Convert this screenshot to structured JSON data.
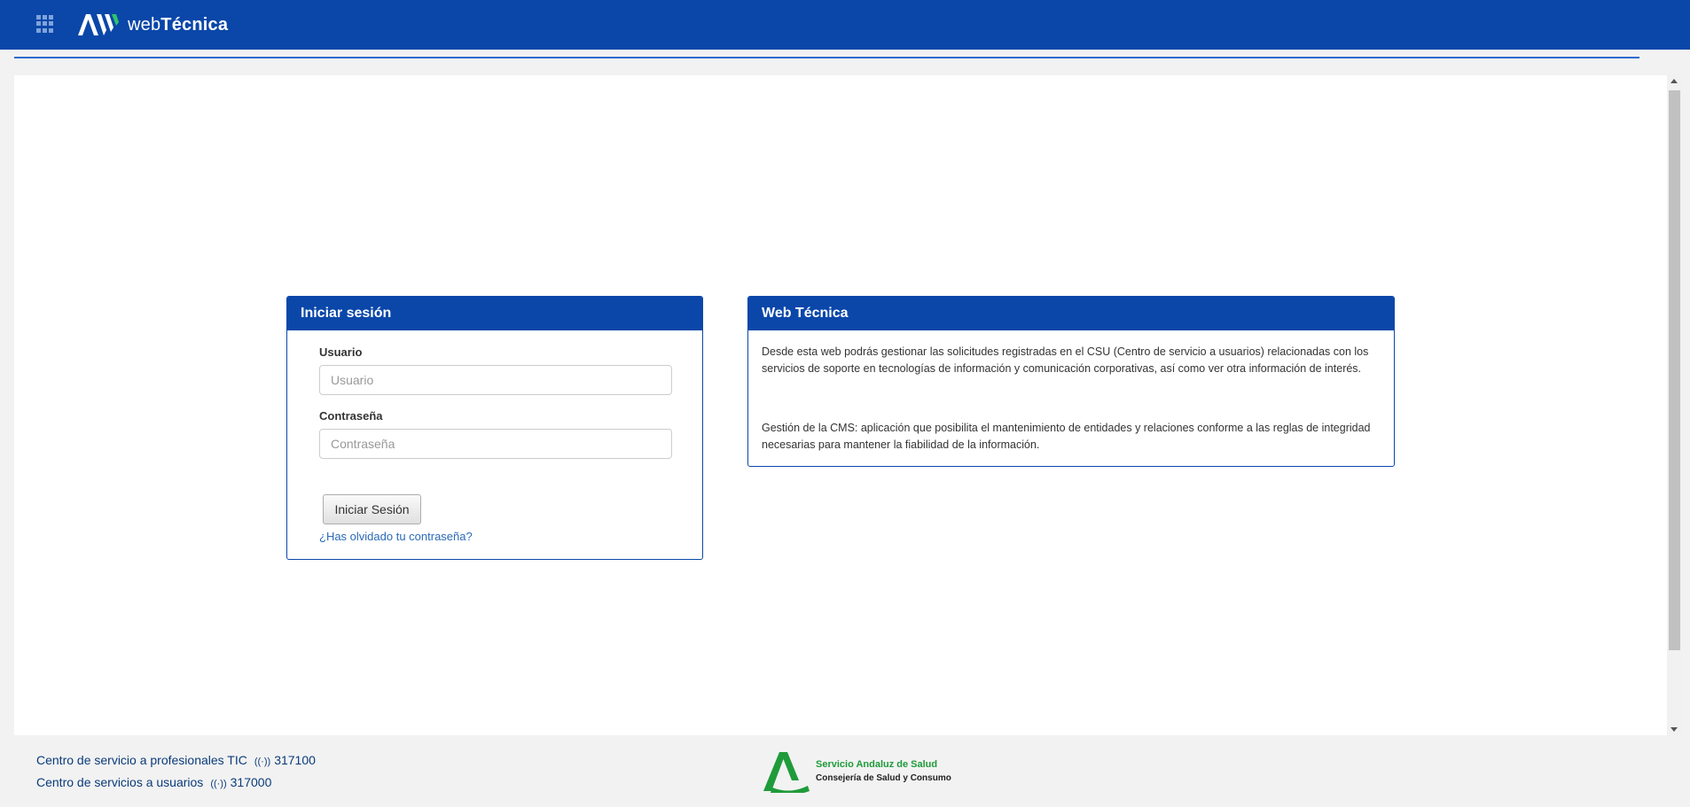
{
  "header": {
    "logo_prefix": "web",
    "logo_bold": "Técnica"
  },
  "login": {
    "title": "Iniciar sesión",
    "user_label": "Usuario",
    "user_placeholder": "Usuario",
    "password_label": "Contraseña",
    "password_placeholder": "Contraseña",
    "submit_label": "Iniciar Sesión",
    "forgot_link": "¿Has olvidado tu contraseña?"
  },
  "info": {
    "title": "Web Técnica",
    "paragraph1": "Desde esta web podrás gestionar las solicitudes registradas en el CSU (Centro de servicio a usuarios) relacionadas con los servicios de soporte en tecnologías de información y comunicación corporativas, así como ver otra información de interés.",
    "paragraph2": "Gestión de la CMS: aplicación que posibilita el mantenimiento de entidades y relaciones conforme a las reglas de integridad necesarias para mantener la fiabilidad de la información."
  },
  "footer": {
    "contacts": [
      {
        "label": "Centro de servicio a profesionales TIC",
        "phone": "317100"
      },
      {
        "label": "Centro de servicios a usuarios",
        "phone": "317000"
      }
    ],
    "org_name": "Servicio Andaluz de Salud",
    "org_dept": "Consejería de Salud y Consumo"
  },
  "colors": {
    "brand_blue": "#0a47a9",
    "link_blue": "#2a6ab7",
    "sas_green": "#1f9b3a"
  }
}
